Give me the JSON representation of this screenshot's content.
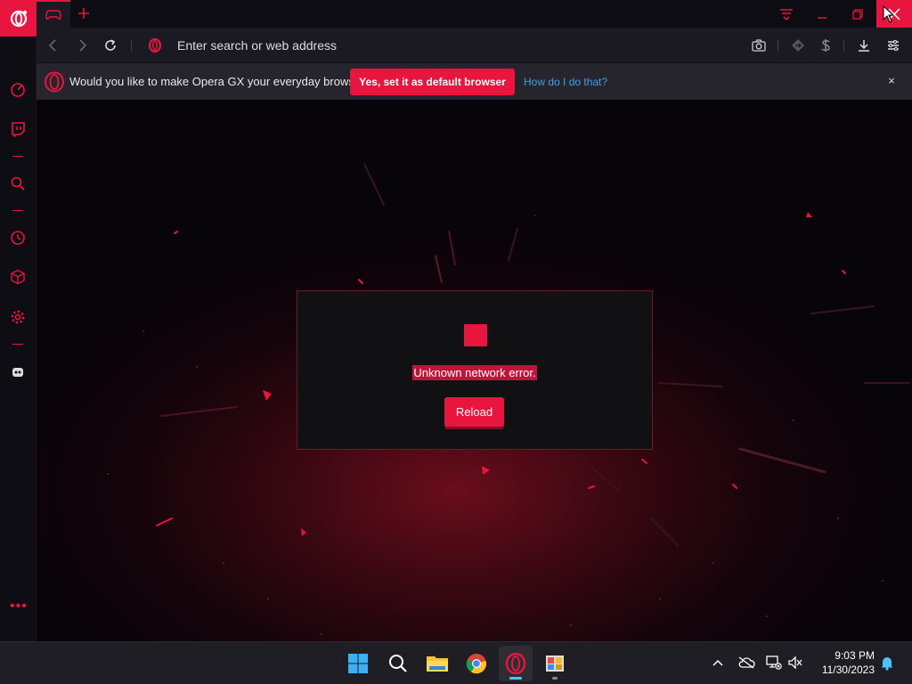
{
  "browser": {
    "address_placeholder": "Enter search or web address",
    "accent_color": "#e8153e"
  },
  "notification": {
    "message": "Would you like to make Opera GX your everyday browser?",
    "accept_label": "Yes, set it as default browser",
    "help_link": "How do I do that?",
    "close_label": "×"
  },
  "error_page": {
    "message": "Unknown network error.",
    "reload_label": "Reload"
  },
  "sidebar": {
    "items": [
      "speed-dial-icon",
      "twitch-icon",
      "search-icon",
      "history-icon",
      "extensions-icon",
      "settings-icon",
      "gx-corner-icon"
    ],
    "more_label": "•••"
  },
  "taskbar": {
    "apps": [
      "start-icon",
      "search-icon",
      "file-explorer-icon",
      "chrome-icon",
      "opera-gx-icon",
      "paint-app-icon"
    ],
    "time": "9:03 PM",
    "date": "11/30/2023"
  }
}
